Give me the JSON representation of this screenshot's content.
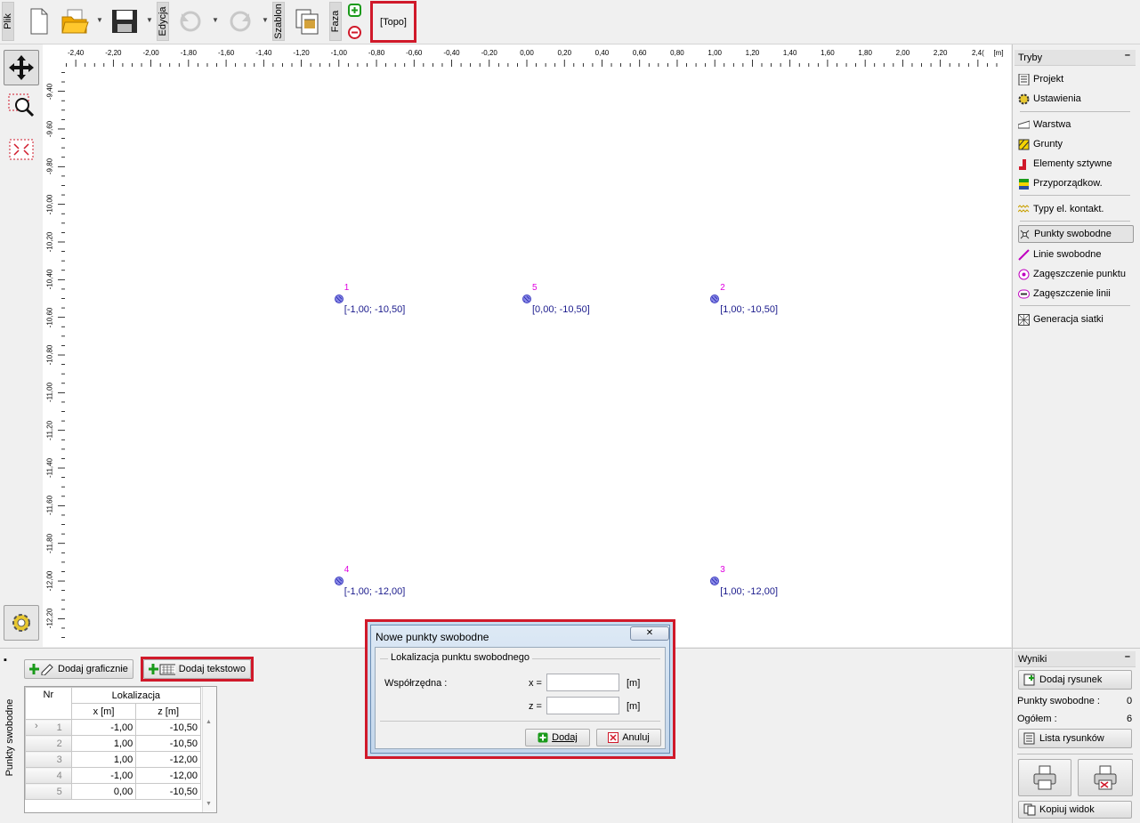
{
  "toolbar": {
    "file_label": "Plik",
    "edit_label": "Edycja",
    "template_label": "Szablon",
    "phase_label": "Faza",
    "phase_name": "[Topo]"
  },
  "ruler": {
    "unit": "[m]",
    "x_ticks": [
      "-2,40",
      "-2,20",
      "-2,00",
      "-1,80",
      "-1,60",
      "-1,40",
      "-1,20",
      "-1,00",
      "-0,80",
      "-0,60",
      "-0,40",
      "-0,20",
      "0,00",
      "0,20",
      "0,40",
      "0,60",
      "0,80",
      "1,00",
      "1,20",
      "1,40",
      "1,60",
      "1,80",
      "2,00",
      "2,20",
      "2,4("
    ],
    "y_ticks": [
      "-9,40",
      "-9,60",
      "-9,80",
      "-10,00",
      "-10,20",
      "-10,40",
      "-10,60",
      "-10,80",
      "-11,00",
      "-11,20",
      "-11,40",
      "-11,60",
      "-11,80",
      "-12,00",
      "-12,20"
    ]
  },
  "points": [
    {
      "nr": "1",
      "label": "[-1,00; -10,50]",
      "x": -1.0,
      "z": -10.5
    },
    {
      "nr": "5",
      "label": "[0,00; -10,50]",
      "x": 0.0,
      "z": -10.5
    },
    {
      "nr": "2",
      "label": "[1,00; -10,50]",
      "x": 1.0,
      "z": -10.5
    },
    {
      "nr": "4",
      "label": "[-1,00; -12,00]",
      "x": -1.0,
      "z": -12.0
    },
    {
      "nr": "3",
      "label": "[1,00; -12,00]",
      "x": 1.0,
      "z": -12.0
    }
  ],
  "modes": {
    "header": "Tryby",
    "items": [
      "Projekt",
      "Ustawienia",
      "Warstwa",
      "Grunty",
      "Elementy sztywne",
      "Przyporządkow.",
      "Typy el. kontakt.",
      "Punkty swobodne",
      "Linie swobodne",
      "Zagęszczenie punktu",
      "Zagęszczenie linii",
      "Generacja siatki"
    ],
    "active": "Punkty swobodne"
  },
  "bottom": {
    "tab_label": "Punkty swobodne",
    "add_graphic": "Dodaj graficznie",
    "add_text": "Dodaj tekstowo",
    "table": {
      "col_nr": "Nr",
      "col_loc": "Lokalizacja",
      "col_x": "x [m]",
      "col_z": "z [m]",
      "rows": [
        {
          "nr": "1",
          "x": "-1,00",
          "z": "-10,50"
        },
        {
          "nr": "2",
          "x": "1,00",
          "z": "-10,50"
        },
        {
          "nr": "3",
          "x": "1,00",
          "z": "-12,00"
        },
        {
          "nr": "4",
          "x": "-1,00",
          "z": "-12,00"
        },
        {
          "nr": "5",
          "x": "0,00",
          "z": "-10,50"
        }
      ]
    }
  },
  "results": {
    "header": "Wyniki",
    "add_drawing": "Dodaj rysunek",
    "free_points_label": "Punkty swobodne :",
    "free_points_value": "0",
    "total_label": "Ogółem :",
    "total_value": "6",
    "list_drawings": "Lista rysunków",
    "copy_view": "Kopiuj widok"
  },
  "dialog": {
    "title": "Nowe punkty swobodne",
    "group_label": "Lokalizacja punktu swobodnego",
    "coord_label": "Współrzędna :",
    "x_label": "x =",
    "z_label": "z =",
    "unit": "[m]",
    "x_value": "",
    "z_value": "",
    "add_button": "Dodaj",
    "cancel_button": "Anuluj",
    "close_glyph": "✕"
  }
}
